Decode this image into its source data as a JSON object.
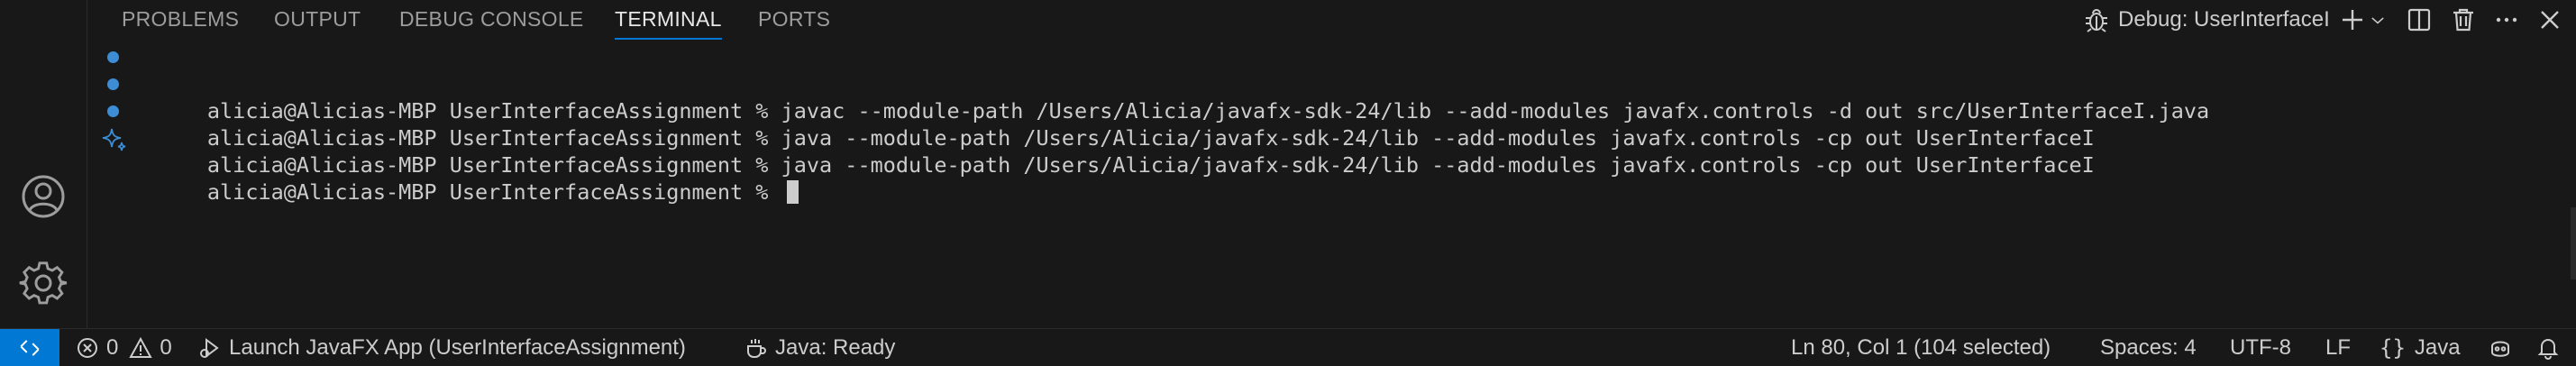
{
  "panel": {
    "tabs": [
      {
        "label": "PROBLEMS"
      },
      {
        "label": "OUTPUT"
      },
      {
        "label": "DEBUG CONSOLE"
      },
      {
        "label": "TERMINAL"
      },
      {
        "label": "PORTS"
      }
    ],
    "active_tab": "TERMINAL",
    "debug_session_label": "Debug: UserInterfaceI"
  },
  "terminal": {
    "lines": [
      {
        "status": "completed",
        "text": "alicia@Alicias-MBP UserInterfaceAssignment % javac --module-path /Users/Alicia/javafx-sdk-24/lib --add-modules javafx.controls -d out src/UserInterfaceI.java"
      },
      {
        "status": "completed",
        "text": "alicia@Alicias-MBP UserInterfaceAssignment % java --module-path /Users/Alicia/javafx-sdk-24/lib --add-modules javafx.controls -cp out UserInterfaceI"
      },
      {
        "status": "completed",
        "text": "alicia@Alicias-MBP UserInterfaceAssignment % java --module-path /Users/Alicia/javafx-sdk-24/lib --add-modules javafx.controls -cp out UserInterfaceI"
      },
      {
        "status": "active",
        "text": "alicia@Alicias-MBP UserInterfaceAssignment % "
      }
    ]
  },
  "status_bar": {
    "errors": "0",
    "warnings": "0",
    "launch_config": "Launch JavaFX App (UserInterfaceAssignment)",
    "java_status": "Java: Ready",
    "cursor_position": "Ln 80, Col 1 (104 selected)",
    "indentation": "Spaces: 4",
    "encoding": "UTF-8",
    "line_ending": "LF",
    "language": "Java"
  },
  "colors": {
    "background": "#181818",
    "accent": "#0078d4",
    "text": "#cccccc",
    "decoration": "#3c8dd5"
  }
}
